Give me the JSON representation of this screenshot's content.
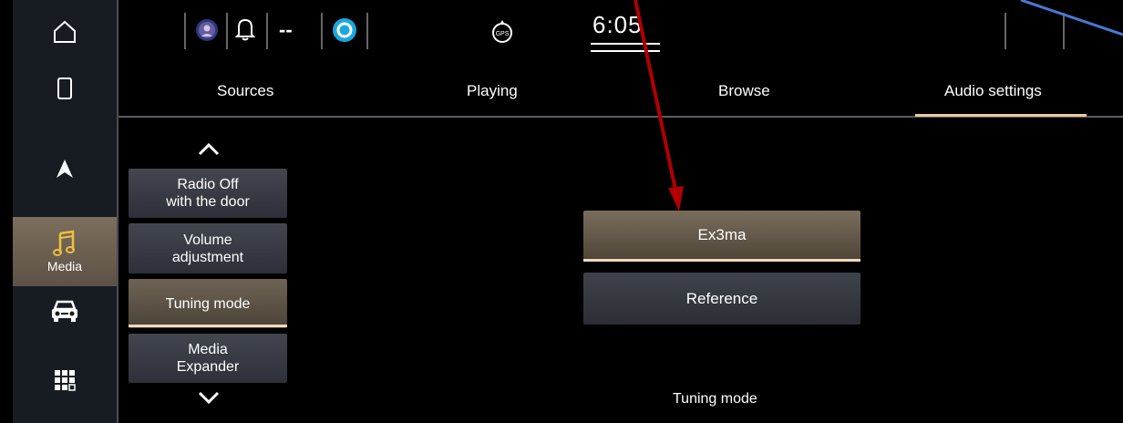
{
  "sidebar": {
    "items": [
      {
        "name": "home"
      },
      {
        "name": "phone"
      },
      {
        "name": "navigation"
      },
      {
        "name": "media",
        "label": "Media"
      },
      {
        "name": "vehicle"
      },
      {
        "name": "apps"
      }
    ]
  },
  "statusbar": {
    "clock": "6:05",
    "signal_text": "--",
    "gps_label": "GPS"
  },
  "tabs": [
    {
      "label": "Sources"
    },
    {
      "label": "Playing"
    },
    {
      "label": "Browse"
    },
    {
      "label": "Audio settings"
    }
  ],
  "settings_list": [
    {
      "label": "Radio Off\nwith the door"
    },
    {
      "label": "Volume\nadjustment"
    },
    {
      "label": "Tuning mode"
    },
    {
      "label": "Media\nExpander"
    }
  ],
  "options": [
    {
      "label": "Ex3ma"
    },
    {
      "label": "Reference"
    }
  ],
  "footer_label": "Tuning mode",
  "colors": {
    "accent": "#e9c8a3",
    "annotation_arrow": "#b00000",
    "annotation_line": "#4a78d4"
  }
}
